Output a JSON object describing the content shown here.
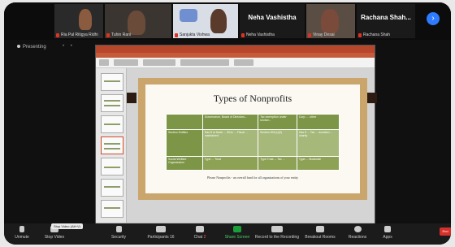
{
  "participants": [
    {
      "name": "Ria Pal Ritigya Ridhi",
      "muted": true
    },
    {
      "name": "Tuhin Rani",
      "muted": true
    },
    {
      "name": "Sanjukta Vishwa",
      "muted": true
    },
    {
      "name": "Neha Vashistha",
      "muted": true
    },
    {
      "name": "Vinay Desai",
      "muted": true
    },
    {
      "name": "Rachana Shah",
      "muted": true
    }
  ],
  "speaker_names": {
    "neha": "Neha Vashistha",
    "rachana": "Rachana Shah..."
  },
  "share_status": "Presenting",
  "share_dots": "• •",
  "slide": {
    "title": "Types of Nonprofits",
    "header_cells": [
      "",
      "Governance, Board of Directors...",
      "Tax exemption under section...",
      "Corp. ... other"
    ],
    "row1": [
      "Section Entities",
      "Has 5 or fewer ... 501c ... Fiscal ... maintained",
      "Section 501(c)(3)",
      "Has 5 ... Tax ... donation ... charity"
    ],
    "row2": [
      "Social Welfare Organization",
      "Type ... Trust",
      "Type Trust ... Tax ...",
      "Type ... Moderate"
    ],
    "note": "Please Nonprofits - an overall fund for all organizations of your entity"
  },
  "toolbar": {
    "mute_label": "Unmute",
    "video_label": "Stop Video",
    "security_label": "Security",
    "participants_label": "Participants",
    "participants_count": "16",
    "chat_label": "Chat",
    "chat_badge": "2",
    "share_label": "Share Screen",
    "record_label": "Record to the Recording",
    "breakout_label": "Breakout Rooms",
    "reactions_label": "Reactions",
    "apps_label": "Apps",
    "end_label": "End",
    "tooltip": "Stop Video (Alt+V)"
  },
  "colors": {
    "share_green": "#1a9e3a",
    "zoom_blue": "#2f7bff",
    "end_red": "#d6302b",
    "slide_green": "#7d9546"
  }
}
